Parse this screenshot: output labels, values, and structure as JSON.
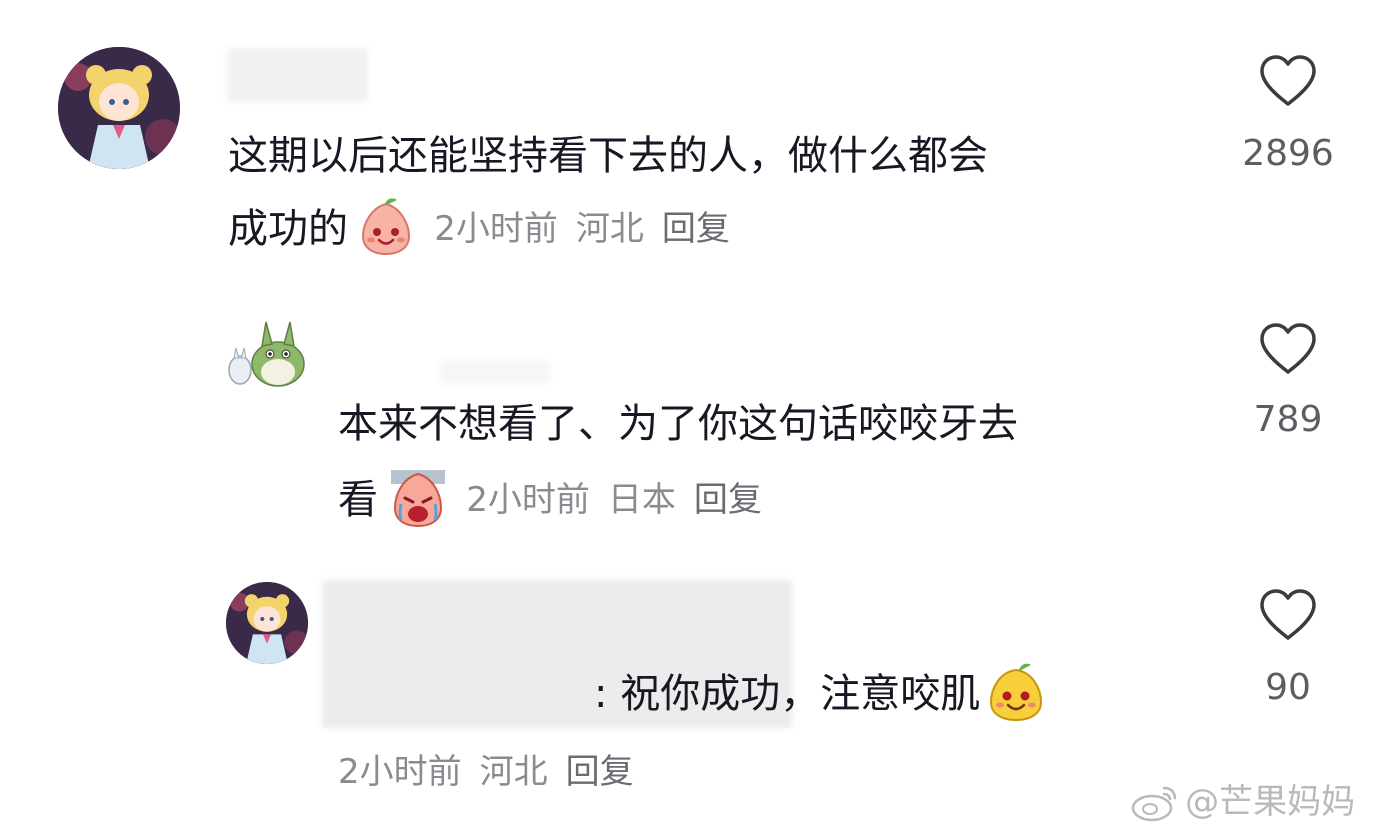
{
  "comments": [
    {
      "text_line1": "这期以后还能坚持看下去的人，做什么都会",
      "text_line2": "成功的",
      "emoji": "blush-peach-emoji",
      "time": "2小时前",
      "location": "河北",
      "reply": "回复",
      "likes": "2896"
    },
    {
      "text_line1": "本来不想看了、为了你这句话咬咬牙去",
      "text_line2": "看",
      "emoji": "crying-peach-emoji",
      "time": "2小时前",
      "location": "日本",
      "reply": "回复",
      "likes": "789"
    },
    {
      "text_line1": ": 祝你成功，注意咬肌",
      "emoji": "smiling-mango-emoji",
      "time": "2小时前",
      "location": "河北",
      "reply": "回复",
      "likes": "90"
    }
  ],
  "watermark": {
    "icon": "weibo-icon",
    "handle": "@芒果妈妈"
  },
  "colors": {
    "text": "#161823",
    "meta": "#8a8b91",
    "like_icon": "#3a3b40"
  }
}
